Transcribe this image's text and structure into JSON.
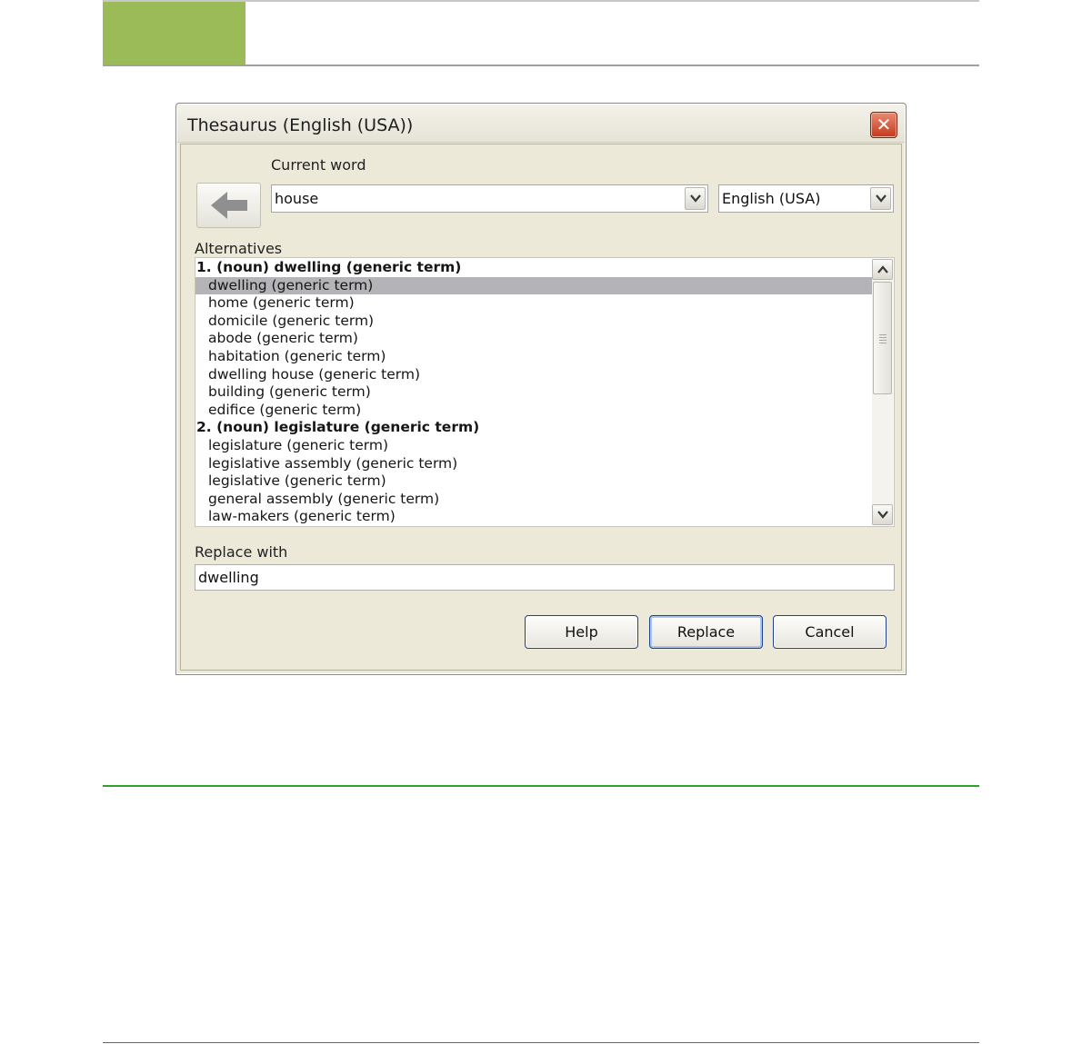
{
  "dialog": {
    "title": "Thesaurus (English (USA))",
    "close_glyph": "✕",
    "current_word_label": "Current word",
    "current_word_value": "house",
    "language_value": "English (USA)",
    "alternatives_label": "Alternatives",
    "replace_with_label": "Replace with",
    "replace_with_value": "dwelling",
    "buttons": {
      "help": "Help",
      "replace": "Replace",
      "cancel": "Cancel"
    }
  },
  "alternatives": [
    {
      "text": "1. (noun) dwelling (generic term)",
      "kind": "header",
      "selected": false
    },
    {
      "text": "dwelling (generic term)",
      "kind": "item",
      "selected": true
    },
    {
      "text": "home (generic term)",
      "kind": "item",
      "selected": false
    },
    {
      "text": "domicile (generic term)",
      "kind": "item",
      "selected": false
    },
    {
      "text": "abode (generic term)",
      "kind": "item",
      "selected": false
    },
    {
      "text": "habitation (generic term)",
      "kind": "item",
      "selected": false
    },
    {
      "text": "dwelling house (generic term)",
      "kind": "item",
      "selected": false
    },
    {
      "text": "building (generic term)",
      "kind": "item",
      "selected": false
    },
    {
      "text": "edifice (generic term)",
      "kind": "item",
      "selected": false
    },
    {
      "text": "2. (noun) legislature (generic term)",
      "kind": "header",
      "selected": false
    },
    {
      "text": "legislature (generic term)",
      "kind": "item",
      "selected": false
    },
    {
      "text": "legislative assembly (generic term)",
      "kind": "item",
      "selected": false
    },
    {
      "text": "legislative (generic term)",
      "kind": "item",
      "selected": false
    },
    {
      "text": "general assembly (generic term)",
      "kind": "item",
      "selected": false
    },
    {
      "text": "law-makers (generic term)",
      "kind": "item",
      "selected": false
    }
  ],
  "colors": {
    "header_block": "#9bbb59",
    "section_rule": "#2ea12e",
    "selection": "#b3b3b8",
    "close_button": "#c4391c"
  },
  "icons": {
    "back": "left-arrow-icon",
    "dropdown": "chevron-down-icon",
    "scroll_up": "chevron-up-icon",
    "scroll_down": "chevron-down-icon",
    "close": "close-icon"
  }
}
